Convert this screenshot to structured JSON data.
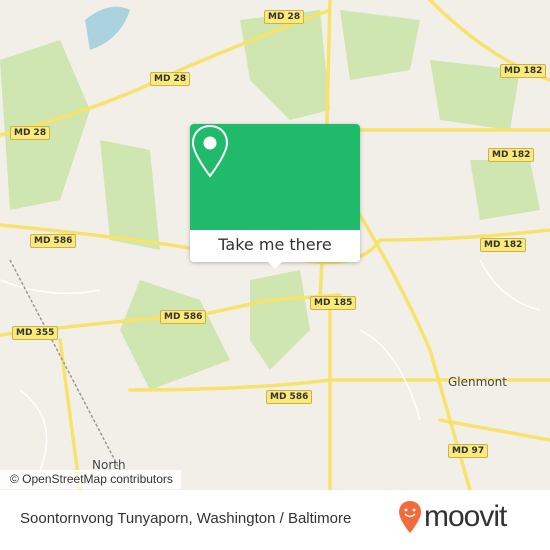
{
  "map": {
    "road_labels": [
      "MD 28",
      "MD 28",
      "MD 28",
      "MD 182",
      "MD 182",
      "MD 182",
      "MD 586",
      "MD 586",
      "MD 586",
      "MD 355",
      "MD 185",
      "MD 97"
    ],
    "places": [
      "Glenmont",
      "North"
    ],
    "attribution": "© OpenStreetMap contributors",
    "colors": {
      "land": "#f2efe9",
      "park": "#cfe6b0",
      "water": "#aad3df",
      "road": "#f7e26b"
    }
  },
  "popup": {
    "button_label": "Take me there",
    "icon": "map-pin-icon",
    "color": "#1fbb6a"
  },
  "footer": {
    "caption": "Soontornvong Tunyaporn, Washington / Baltimore",
    "logo_text": "moovit",
    "logo_icon": "moovit-pin-icon",
    "logo_color": "#f26b3a"
  }
}
